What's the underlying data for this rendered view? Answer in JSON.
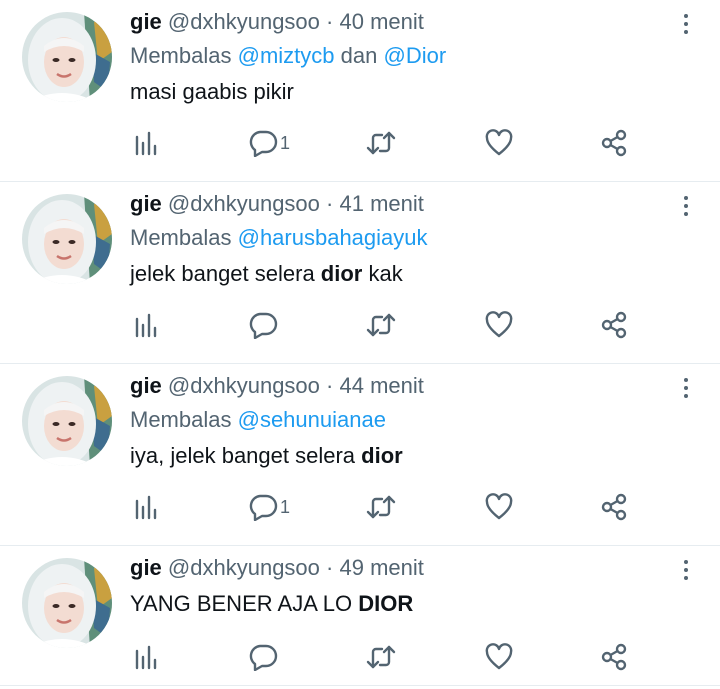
{
  "tweets": [
    {
      "name": "gie",
      "handle": "@dxhkyungsoo",
      "separator": "·",
      "time": "40 menit",
      "reply_prefix": "Membalas",
      "mentions": [
        "@miztycb",
        "@Dior"
      ],
      "reply_joiner": "dan",
      "text_parts": [
        "masi gaabis pikir",
        "",
        ""
      ],
      "reply_count": "1"
    },
    {
      "name": "gie",
      "handle": "@dxhkyungsoo",
      "separator": "·",
      "time": "41 menit",
      "reply_prefix": "Membalas",
      "mentions": [
        "@harusbahagiayuk"
      ],
      "text_parts": [
        "jelek banget selera ",
        "dior",
        " kak"
      ],
      "reply_count": ""
    },
    {
      "name": "gie",
      "handle": "@dxhkyungsoo",
      "separator": "·",
      "time": "44 menit",
      "reply_prefix": "Membalas",
      "mentions": [
        "@sehunuianae"
      ],
      "text_parts": [
        "iya, jelek banget selera ",
        "dior",
        ""
      ],
      "reply_count": "1"
    },
    {
      "name": "gie",
      "handle": "@dxhkyungsoo",
      "separator": "·",
      "time": "49 menit",
      "text_parts": [
        "YANG BENER AJA LO ",
        "DIOR",
        ""
      ],
      "reply_count": ""
    }
  ],
  "icons": {
    "more": "more-vertical-icon",
    "views": "analytics-icon",
    "reply": "reply-bubble-icon",
    "retweet": "retweet-icon",
    "like": "heart-icon",
    "share": "share-icon"
  },
  "colors": {
    "text": "#0f1419",
    "secondary": "#536471",
    "link": "#1d9bf0",
    "divider": "#e6ecf0"
  }
}
